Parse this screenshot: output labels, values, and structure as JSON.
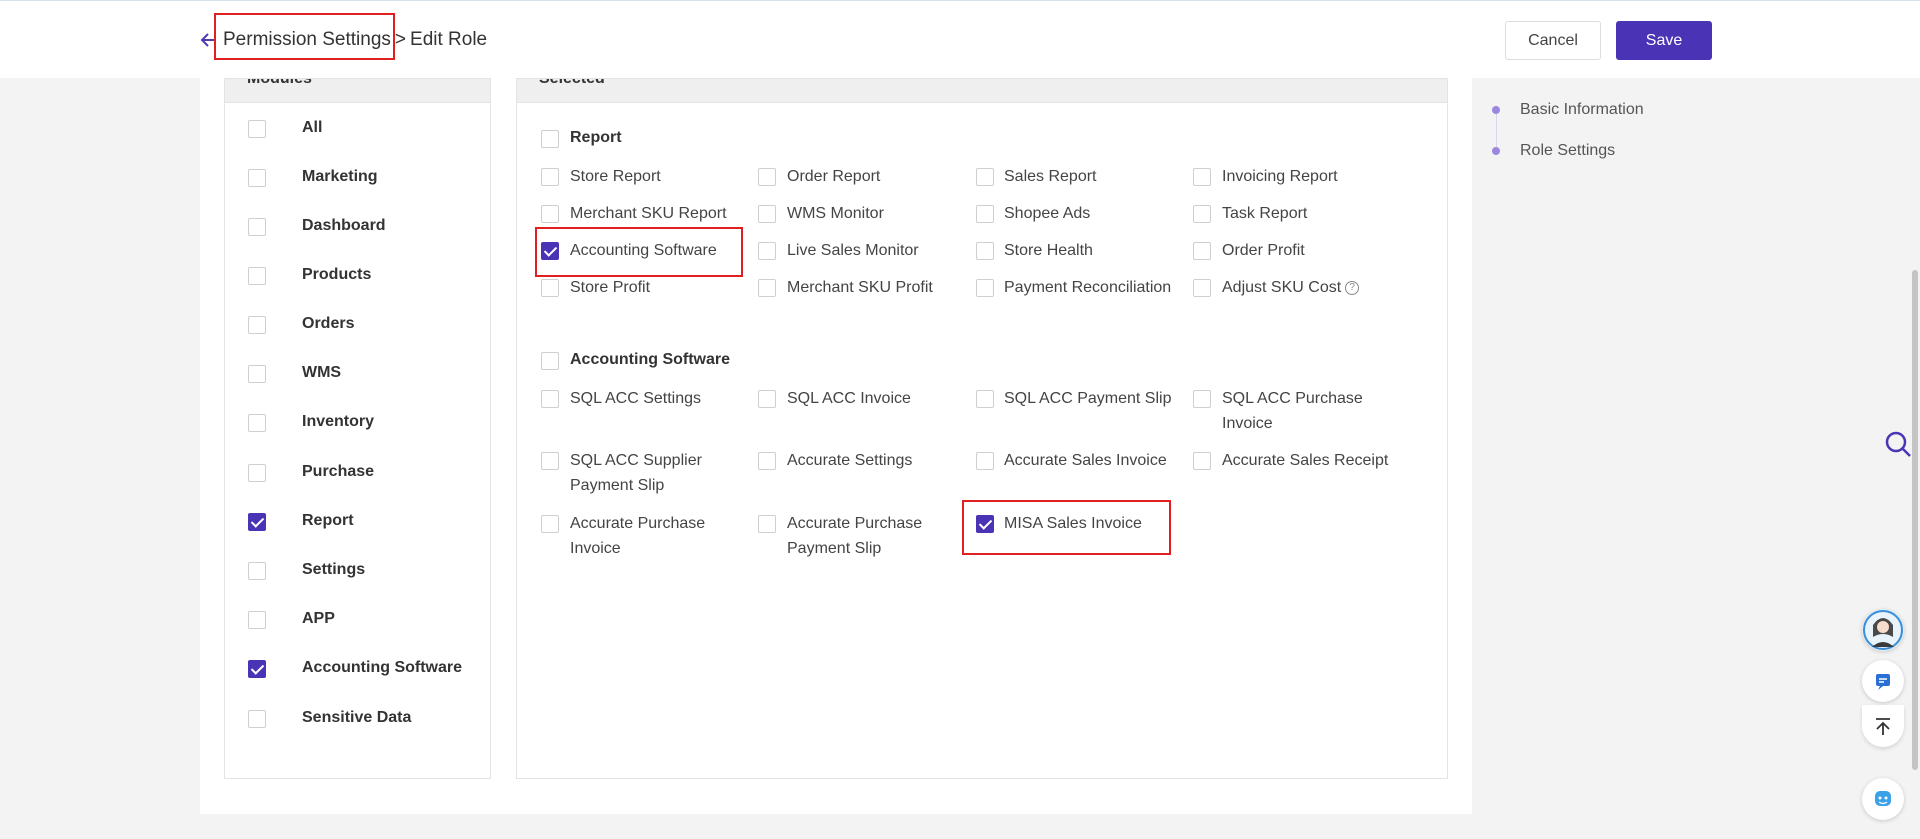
{
  "header": {
    "breadcrumb_parent": "Permission Settings",
    "breadcrumb_separator": ">",
    "breadcrumb_current": "Edit Role",
    "cancel_label": "Cancel",
    "save_label": "Save"
  },
  "modules": {
    "title": "Modules",
    "items": [
      {
        "label": "All",
        "checked": false
      },
      {
        "label": "Marketing",
        "checked": false
      },
      {
        "label": "Dashboard",
        "checked": false
      },
      {
        "label": "Products",
        "checked": false
      },
      {
        "label": "Orders",
        "checked": false
      },
      {
        "label": "WMS",
        "checked": false
      },
      {
        "label": "Inventory",
        "checked": false
      },
      {
        "label": "Purchase",
        "checked": false
      },
      {
        "label": "Report",
        "checked": true
      },
      {
        "label": "Settings",
        "checked": false
      },
      {
        "label": "APP",
        "checked": false
      },
      {
        "label": "Accounting Software",
        "checked": true
      },
      {
        "label": "Sensitive Data",
        "checked": false
      }
    ]
  },
  "selected": {
    "title": "Selected",
    "report": {
      "label": "Report",
      "items": [
        {
          "label": "Store Report",
          "checked": false
        },
        {
          "label": "Order Report",
          "checked": false
        },
        {
          "label": "Sales Report",
          "checked": false
        },
        {
          "label": "Invoicing Report",
          "checked": false
        },
        {
          "label": "Merchant SKU Report",
          "checked": false
        },
        {
          "label": "WMS Monitor",
          "checked": false
        },
        {
          "label": "Shopee Ads",
          "checked": false
        },
        {
          "label": "Task Report",
          "checked": false
        },
        {
          "label": "Accounting Software",
          "checked": true
        },
        {
          "label": "Live Sales Monitor",
          "checked": false
        },
        {
          "label": "Store Health",
          "checked": false
        },
        {
          "label": "Order Profit",
          "checked": false
        },
        {
          "label": "Store Profit",
          "checked": false
        },
        {
          "label": "Merchant SKU Profit",
          "checked": false
        },
        {
          "label": "Payment Reconciliation",
          "checked": false
        },
        {
          "label": "Adjust SKU Cost",
          "checked": false
        }
      ]
    },
    "accounting": {
      "label": "Accounting Software",
      "items": [
        {
          "label": "SQL ACC Settings",
          "checked": false
        },
        {
          "label": "SQL ACC Invoice",
          "checked": false
        },
        {
          "label": "SQL ACC Payment Slip",
          "checked": false
        },
        {
          "label": "SQL ACC Purchase Invoice",
          "checked": false
        },
        {
          "label": "SQL ACC Supplier Payment Slip",
          "checked": false
        },
        {
          "label": "Accurate Settings",
          "checked": false
        },
        {
          "label": "Accurate Sales Invoice",
          "checked": false
        },
        {
          "label": "Accurate Sales Receipt",
          "checked": false
        },
        {
          "label": "Accurate Purchase Invoice",
          "checked": false
        },
        {
          "label": "Accurate Purchase Payment Slip",
          "checked": false
        },
        {
          "label": "MISA Sales Invoice",
          "checked": true
        }
      ]
    }
  },
  "right_nav": {
    "items": [
      {
        "label": "Basic Information"
      },
      {
        "label": "Role Settings"
      }
    ]
  },
  "colors": {
    "accent": "#4b33b5",
    "highlight": "#e02020"
  },
  "icons": {
    "back": "arrow-left-icon",
    "help": "question-circle-icon",
    "search": "search-icon",
    "avatar": "support-avatar-icon",
    "chat": "chat-icon",
    "top": "back-to-top-icon",
    "assistant": "assistant-icon"
  }
}
